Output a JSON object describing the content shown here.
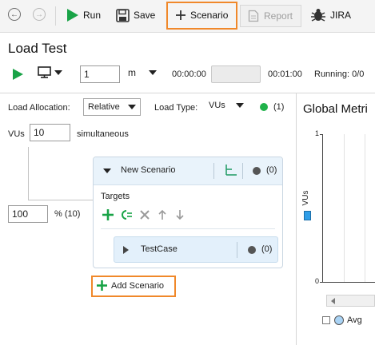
{
  "toolbar": {
    "run_label": "Run",
    "save_label": "Save",
    "scenario_label": "Scenario",
    "report_label": "Report",
    "jira_label": "JIRA"
  },
  "page": {
    "title": "Load Test"
  },
  "controls": {
    "users_value": "1",
    "unit_value": "m",
    "time_start": "00:00:00",
    "time_end": "00:01:00",
    "running_label": "Running: 0/0"
  },
  "allocation": {
    "load_allocation_label": "Load Allocation:",
    "load_allocation_value": "Relative",
    "load_type_label": "Load Type:",
    "load_type_value": "VUs",
    "count": "(1)",
    "vus_label": "VUs",
    "vus_value": "10",
    "simultaneous_label": "simultaneous",
    "percent_value": "100",
    "percent_suffix": "% (10)"
  },
  "scenario": {
    "name": "New Scenario",
    "count": "(0)",
    "targets_label": "Targets",
    "testcase_name": "TestCase",
    "testcase_count": "(0)",
    "add_label": "Add Scenario"
  },
  "chart": {
    "title": "Global Metri",
    "y_axis_label": "VUs",
    "y_tick_top": "1",
    "y_tick_bottom": "0",
    "legend_avg": "Avg"
  },
  "colors": {
    "accent_orange": "#f0882a",
    "run_green": "#19a347",
    "status_green": "#20b24a",
    "legend_blue": "#2f9ee8"
  }
}
